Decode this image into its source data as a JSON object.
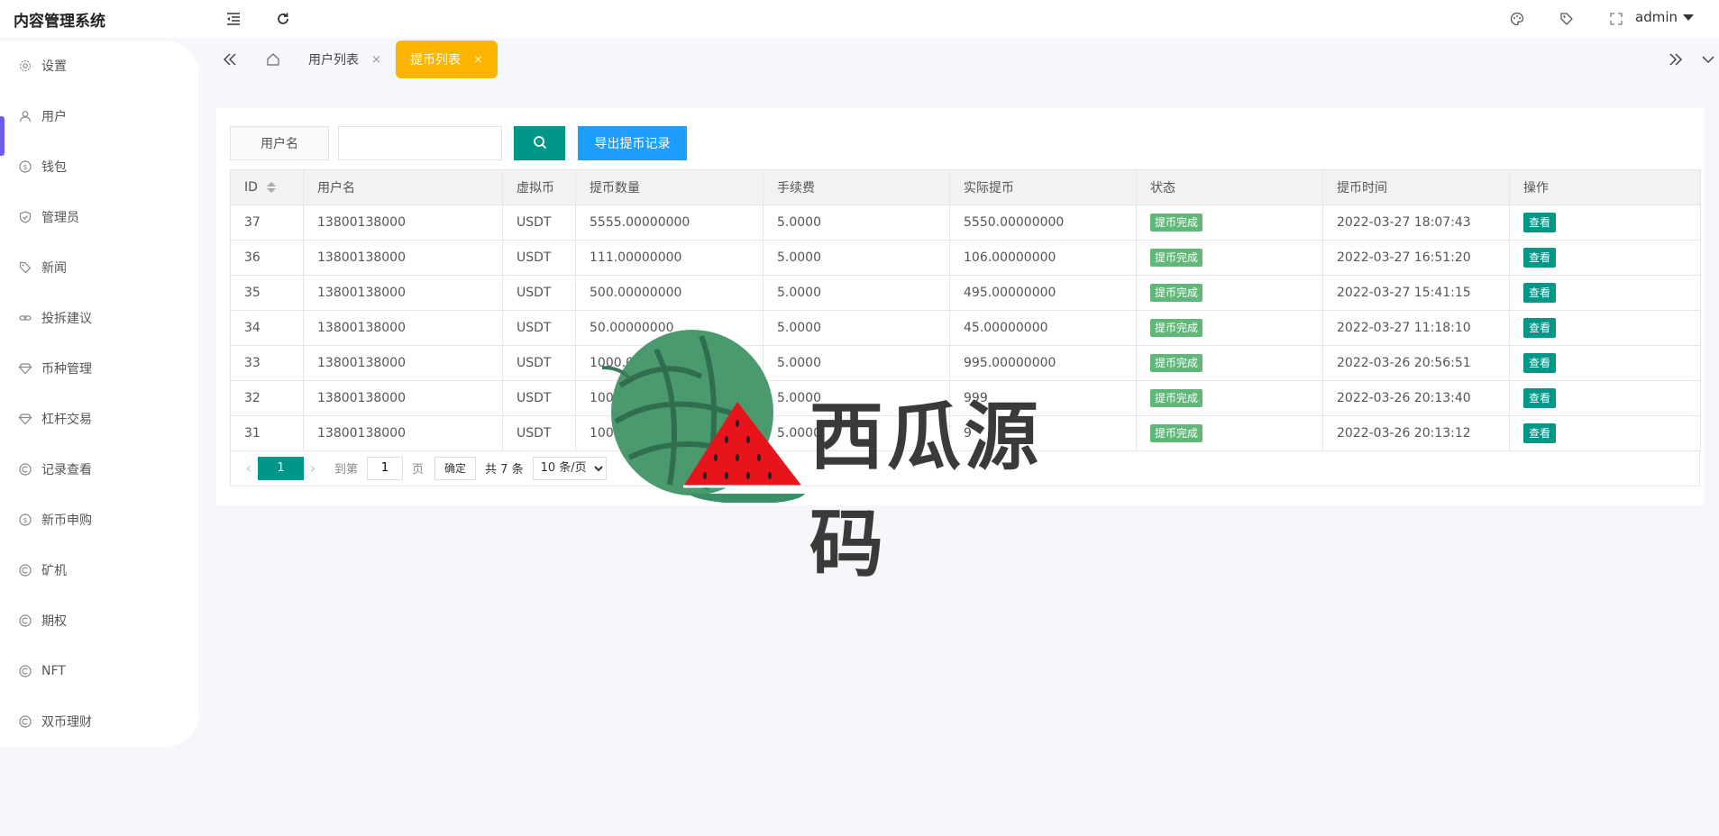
{
  "app": {
    "title": "内容管理系统"
  },
  "header": {
    "icons": [
      "menu-fold-icon",
      "refresh-icon",
      "palette-icon",
      "tag-icon",
      "fullscreen-icon"
    ],
    "user": "admin"
  },
  "sidebar": {
    "items": [
      {
        "label": "设置",
        "icon": "gear-icon"
      },
      {
        "label": "用户",
        "icon": "user-icon"
      },
      {
        "label": "钱包",
        "icon": "dollar-icon"
      },
      {
        "label": "管理员",
        "icon": "shield-icon"
      },
      {
        "label": "新闻",
        "icon": "tag-icon"
      },
      {
        "label": "投拆建议",
        "icon": "link-icon"
      },
      {
        "label": "币种管理",
        "icon": "diamond-icon"
      },
      {
        "label": "杠杆交易",
        "icon": "diamond-icon"
      },
      {
        "label": "记录查看",
        "icon": "circle-c-icon"
      },
      {
        "label": "新币申购",
        "icon": "dollar-icon"
      },
      {
        "label": "矿机",
        "icon": "circle-c-icon"
      },
      {
        "label": "期权",
        "icon": "circle-c-icon"
      },
      {
        "label": "NFT",
        "icon": "circle-c-icon"
      },
      {
        "label": "双币理财",
        "icon": "circle-c-icon"
      }
    ],
    "active_index": 1
  },
  "tabs": {
    "items": [
      {
        "label": "用户列表",
        "close": "×"
      },
      {
        "label": "提币列表",
        "close": "×"
      }
    ],
    "active_index": 1
  },
  "search": {
    "label": "用户名",
    "value": "",
    "placeholder": "",
    "export_label": "导出提币记录"
  },
  "table": {
    "columns": [
      "ID",
      "用户名",
      "虚拟币",
      "提币数量",
      "手续费",
      "实际提币",
      "状态",
      "提币时间",
      "操作"
    ],
    "rows": [
      [
        "37",
        "13800138000",
        "USDT",
        "5555.00000000",
        "5.0000",
        "5550.00000000",
        "提币完成",
        "2022-03-27 18:07:43",
        "查看"
      ],
      [
        "36",
        "13800138000",
        "USDT",
        "111.00000000",
        "5.0000",
        "106.00000000",
        "提币完成",
        "2022-03-27 16:51:20",
        "查看"
      ],
      [
        "35",
        "13800138000",
        "USDT",
        "500.00000000",
        "5.0000",
        "495.00000000",
        "提币完成",
        "2022-03-27 15:41:15",
        "查看"
      ],
      [
        "34",
        "13800138000",
        "USDT",
        "50.00000000",
        "5.0000",
        "45.00000000",
        "提币完成",
        "2022-03-27 11:18:10",
        "查看"
      ],
      [
        "33",
        "13800138000",
        "USDT",
        "1000.000",
        "5.0000",
        "995.00000000",
        "提币完成",
        "2022-03-26 20:56:51",
        "查看"
      ],
      [
        "32",
        "13800138000",
        "USDT",
        "10000",
        "5.0000",
        "999",
        "提币完成",
        "2022-03-26 20:13:40",
        "查看"
      ],
      [
        "31",
        "13800138000",
        "USDT",
        "10000",
        "5.0000",
        "9",
        "提币完成",
        "2022-03-26 20:13:12",
        "查看"
      ]
    ]
  },
  "pagination": {
    "current": "1",
    "goto_label": "到第",
    "goto_value": "1",
    "page_unit": "页",
    "confirm_label": "确定",
    "total_label": "共 7 条",
    "page_size": "10 条/页"
  },
  "watermark": {
    "text": "西瓜源码"
  },
  "colors": {
    "accent_purple": "#6d5bf2",
    "tab_active": "#fbb500",
    "primary_teal": "#009688",
    "export_blue": "#1e9fff",
    "status_green": "#5fb878"
  }
}
